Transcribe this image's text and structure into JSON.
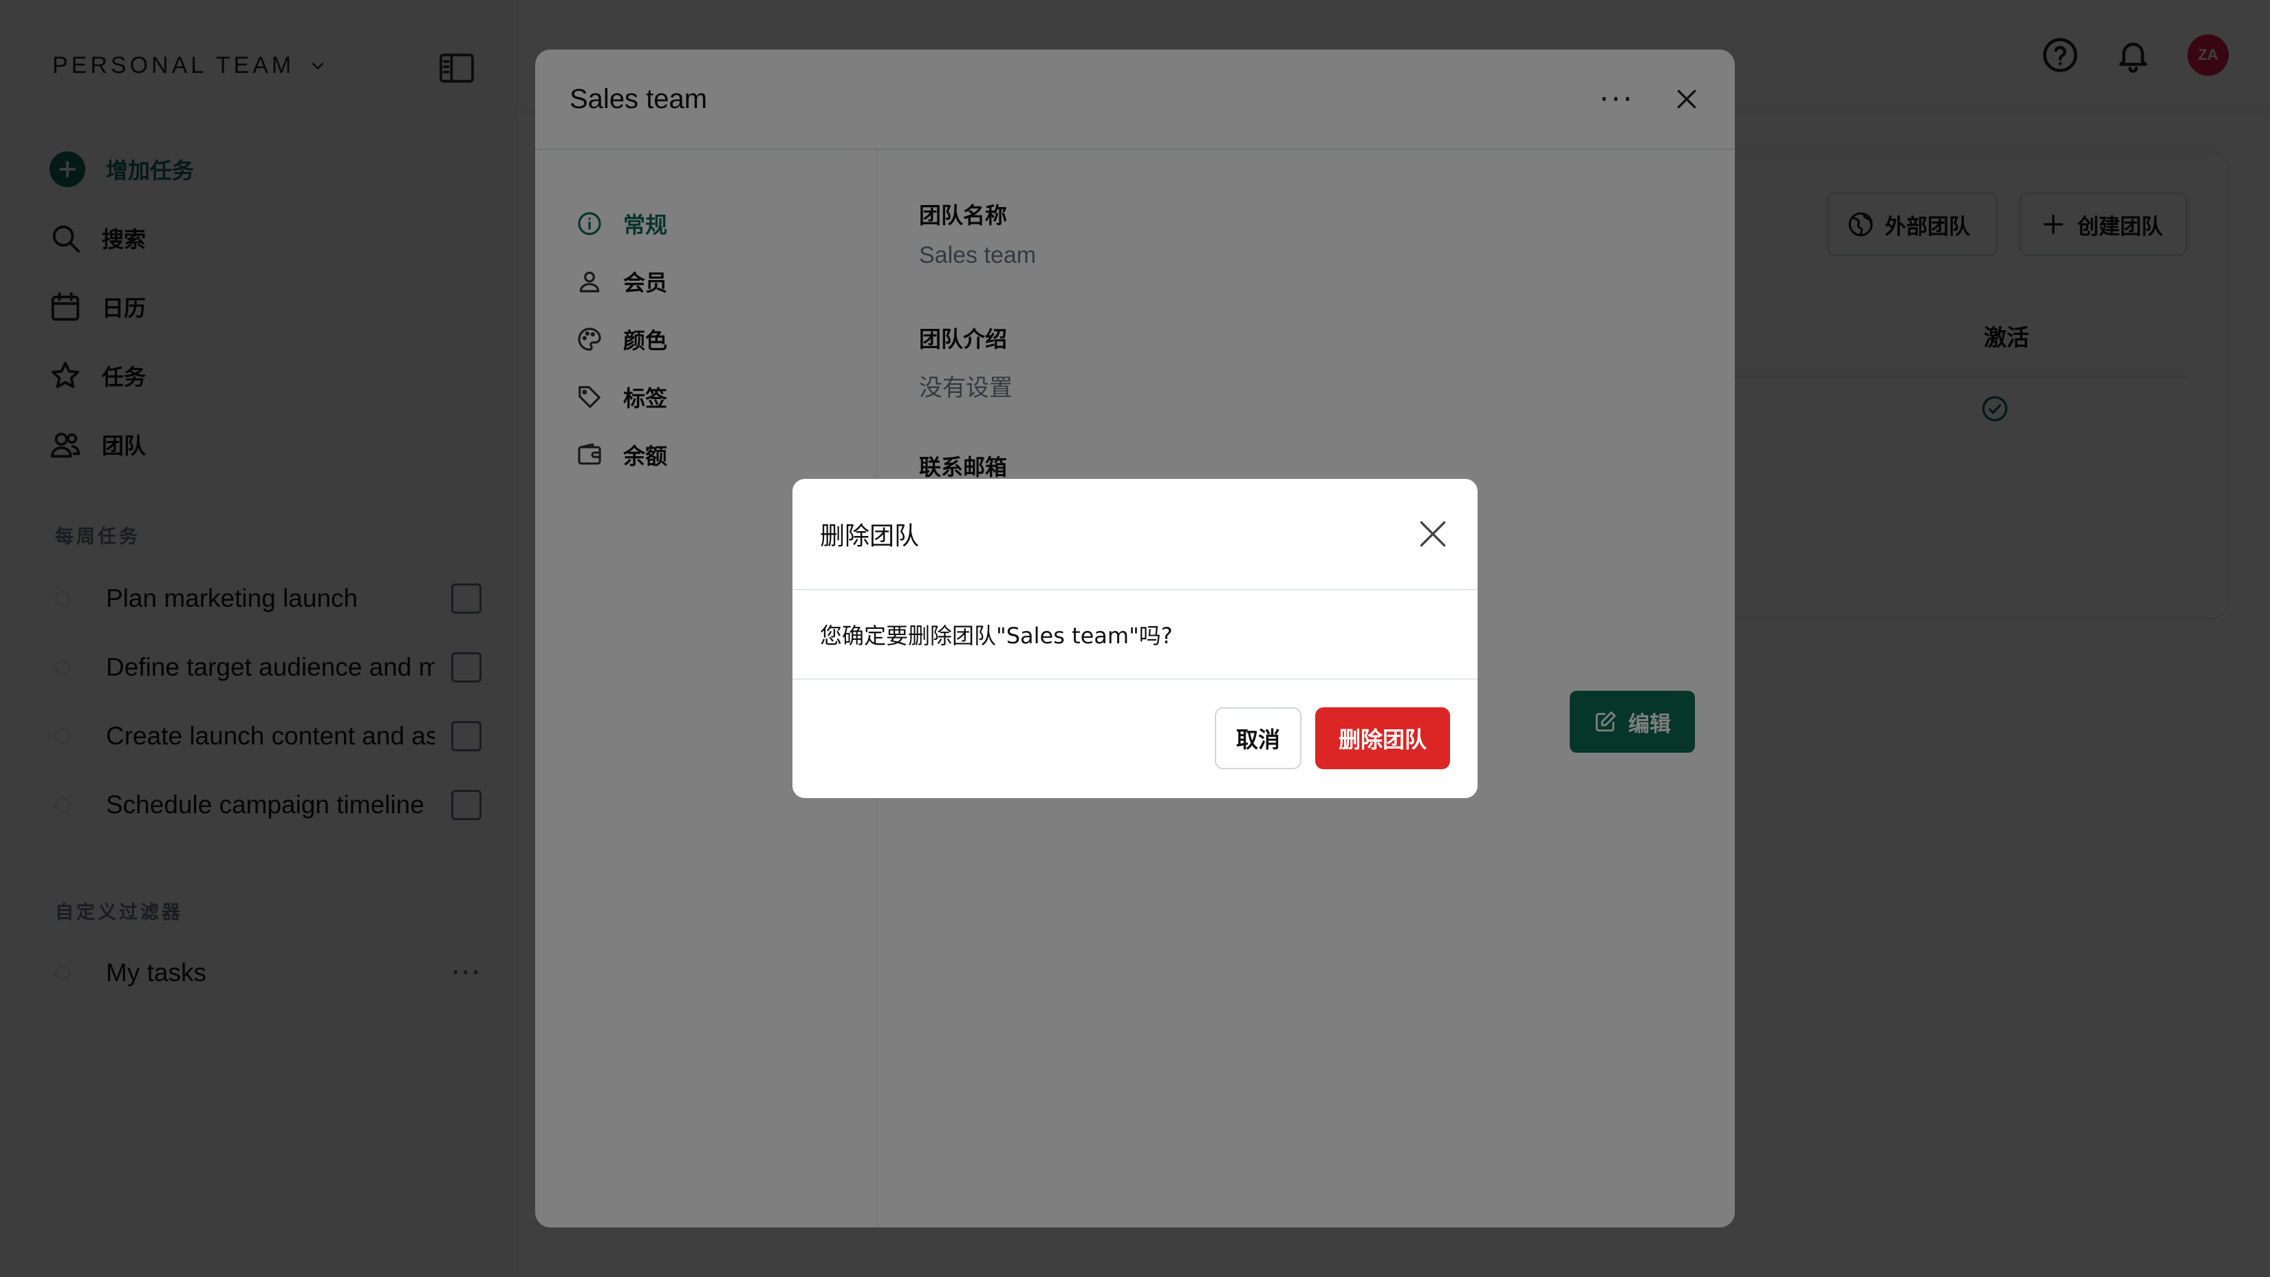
{
  "sidebar": {
    "team_name": "PERSONAL TEAM",
    "nav": [
      {
        "label": "增加任务",
        "icon": "plus-circle-icon"
      },
      {
        "label": "搜索",
        "icon": "search-icon"
      },
      {
        "label": "日历",
        "icon": "calendar-icon"
      },
      {
        "label": "任务",
        "icon": "star-icon"
      },
      {
        "label": "团队",
        "icon": "users-icon"
      }
    ],
    "weekly_title": "每周任务",
    "weekly_tasks": [
      {
        "label": "Plan marketing launch"
      },
      {
        "label": "Define target audience and messaging"
      },
      {
        "label": "Create launch content and assets"
      },
      {
        "label": "Schedule campaign timeline"
      }
    ],
    "filters_title": "自定义过滤器",
    "filters": [
      {
        "label": "My tasks",
        "more": "···"
      }
    ]
  },
  "header": {
    "avatar_initials": "ZA"
  },
  "page": {
    "external_team_label": "外部团队",
    "create_team_label": "创建团队",
    "active_col_header": "激活"
  },
  "team_modal": {
    "title": "Sales team",
    "more": "···",
    "nav": [
      {
        "label": "常规",
        "icon": "info-icon"
      },
      {
        "label": "会员",
        "icon": "user-icon"
      },
      {
        "label": "颜色",
        "icon": "palette-icon"
      },
      {
        "label": "标签",
        "icon": "tag-icon"
      },
      {
        "label": "余额",
        "icon": "wallet-icon"
      }
    ],
    "fields": [
      {
        "label": "团队名称",
        "value": "Sales team"
      },
      {
        "label": "团队介绍",
        "value": "没有设置"
      },
      {
        "label": "联系邮箱",
        "value": ""
      }
    ],
    "edit_label": "编辑"
  },
  "dialog": {
    "title": "删除团队",
    "message": "您确定要删除团队\"Sales team\"吗?",
    "cancel_label": "取消",
    "delete_label": "删除团队"
  },
  "colors": {
    "brand": "#0d6b55",
    "danger": "#dc2626",
    "avatar": "#e11d48"
  }
}
